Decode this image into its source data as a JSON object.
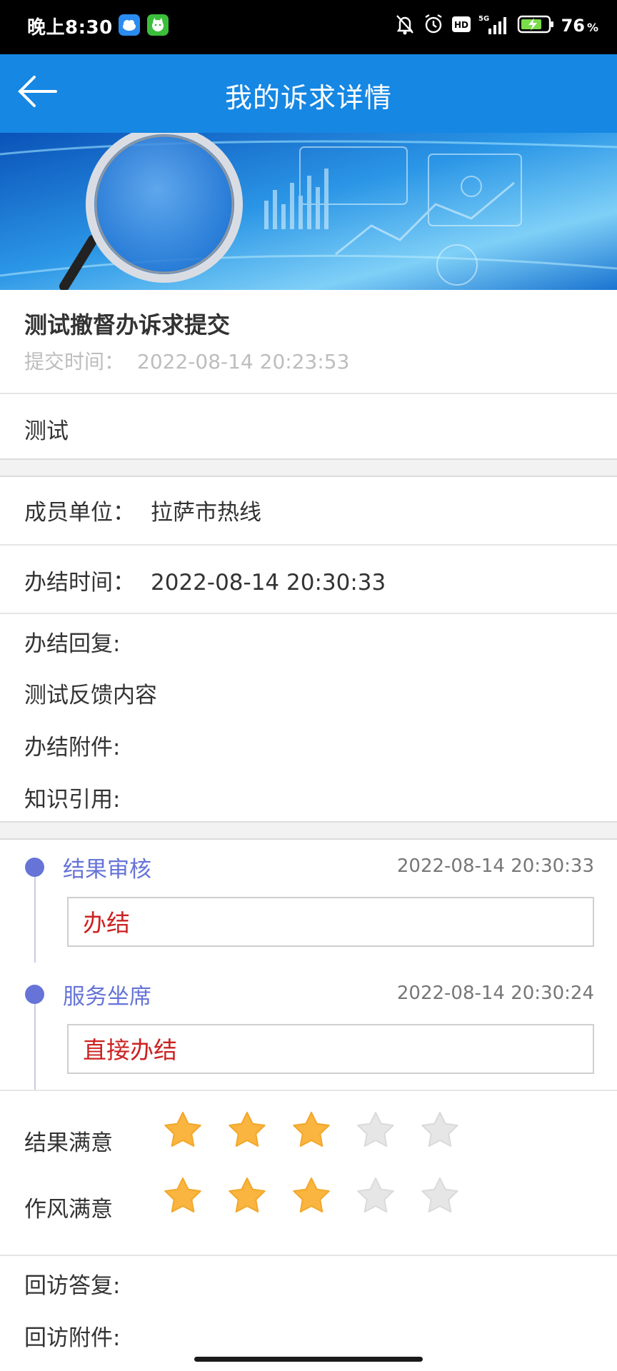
{
  "status_bar": {
    "time": "晚上8:30",
    "icons": [
      "app-cloud-icon",
      "app-cat-icon",
      "mute-bell-icon",
      "alarm-icon",
      "hd-icon",
      "5g-signal-icon",
      "battery-charging-icon"
    ],
    "battery_pct": "76",
    "battery_unit": "%"
  },
  "header": {
    "title": "我的诉求详情",
    "back_icon": "back-arrow-icon"
  },
  "appeal": {
    "title": "测试撤督办诉求提交",
    "submit_label": "提交时间：",
    "submit_time": "2022-08-14 20:23:53",
    "content": "测试"
  },
  "handling": {
    "unit_label": "成员单位：",
    "unit_value": "拉萨市热线",
    "done_time_label": "办结时间：",
    "done_time_value": "2022-08-14 20:30:33",
    "reply_label": "办结回复:",
    "reply_value": "测试反馈内容",
    "attachment_label": "办结附件:",
    "knowledge_label": "知识引用:"
  },
  "timeline": [
    {
      "name": "结果审核",
      "time": "2022-08-14 20:30:33",
      "action": "办结"
    },
    {
      "name": "服务坐席",
      "time": "2022-08-14 20:30:24",
      "action": "直接办结"
    }
  ],
  "ratings": [
    {
      "label": "结果满意",
      "filled": 3,
      "max": 5
    },
    {
      "label": "作风满意",
      "filled": 3,
      "max": 5
    }
  ],
  "visit": {
    "reply_label": "回访答复:",
    "attachment_label": "回访附件:"
  },
  "colors": {
    "app_bar": "#1687e3",
    "timeline_accent": "#6674d8",
    "action_text": "#cc2222",
    "star_filled": "#f9b53f",
    "star_empty": "#e6e6e6"
  }
}
